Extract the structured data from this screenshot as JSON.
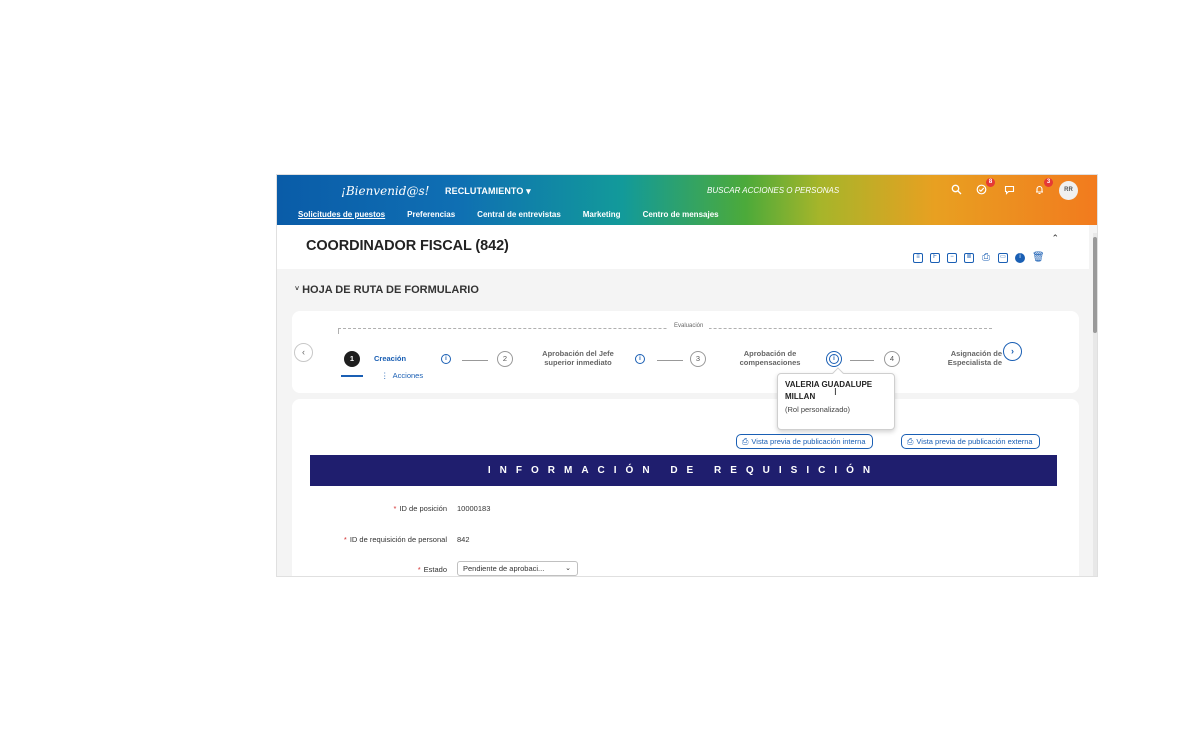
{
  "header": {
    "logo_text": "¡Bienvenid@s!",
    "module_menu": "RECLUTAMIENTO ▾",
    "search_placeholder": "BUSCAR ACCIONES O PERSONAS",
    "todo_badge": "8",
    "notifications_badge": "3",
    "avatar_initials": "RR"
  },
  "nav": {
    "tabs": [
      {
        "label": "Solicitudes de puestos",
        "active": true
      },
      {
        "label": "Preferencias"
      },
      {
        "label": "Central de entrevistas"
      },
      {
        "label": "Marketing"
      },
      {
        "label": "Centro de mensajes"
      }
    ]
  },
  "page": {
    "title": "COORDINADOR FISCAL (842)",
    "toolbar_icons": [
      "document-icon",
      "form-icon",
      "minus-box-icon",
      "clipboard-icon",
      "print-icon",
      "save-icon",
      "info-icon",
      "trash-icon"
    ]
  },
  "route_map": {
    "section_title": "HOJA DE RUTA DE FORMULARIO",
    "group_label": "Evaluación",
    "steps": [
      {
        "number": "1",
        "label": "Creación",
        "active": true
      },
      {
        "number": "2",
        "label_line1": "Aprobación del Jefe",
        "label_line2": "superior inmediato"
      },
      {
        "number": "3",
        "label_line1": "Aprobación de",
        "label_line2": "compensaciones"
      },
      {
        "number": "4",
        "label_line1": "Asignación de",
        "label_line2": "Especialista de"
      }
    ],
    "actions_label": "Acciones",
    "tooltip": {
      "name": "VALERIA GUADALUPE MILLAN",
      "role": "(Rol personalizado)"
    }
  },
  "form": {
    "preview_internal": "Vista previa de publicación interna",
    "preview_external": "Vista previa de publicación externa",
    "banner": "INFORMACIÓN DE REQUISICIÓN",
    "fields": {
      "position_id": {
        "label": "ID de posición",
        "value": "10000183"
      },
      "requisition_id": {
        "label": "ID de requisición de personal",
        "value": "842"
      },
      "status": {
        "label": "Estado",
        "value": "Pendiente de aprobaci..."
      }
    }
  },
  "colors": {
    "accent": "#1a5fb4",
    "banner": "#1f1e6e",
    "required": "#d32f2f"
  }
}
